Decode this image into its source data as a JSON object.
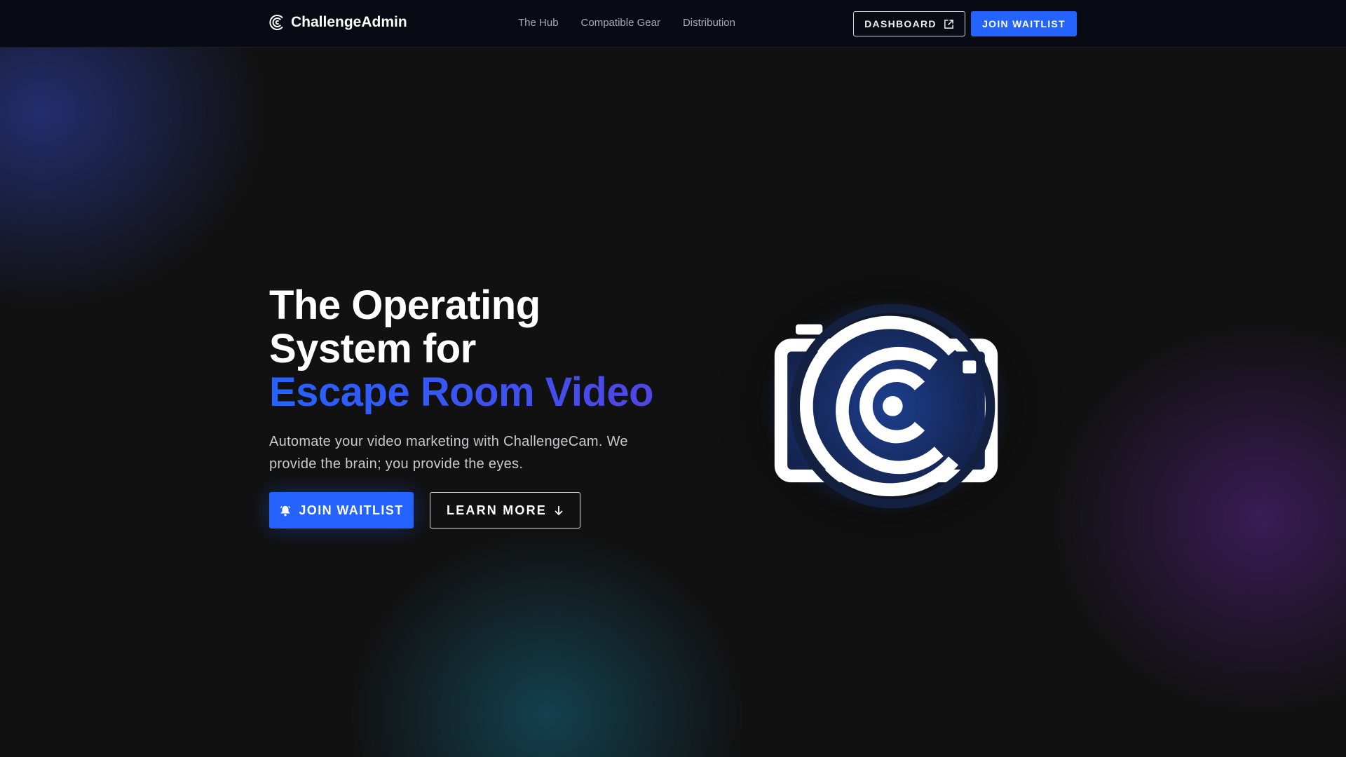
{
  "nav": {
    "brand": "ChallengeAdmin",
    "links": [
      "The Hub",
      "Compatible Gear",
      "Distribution"
    ],
    "dashboard_label": "DASHBOARD",
    "join_label": "JOIN WAITLIST"
  },
  "hero": {
    "title_line1": "The Operating",
    "title_line2": "System for",
    "title_accent": "Escape Room Video",
    "subtitle": "Automate your video marketing with ChallengeCam. We provide the brain; you provide the eyes.",
    "join_label": "JOIN WAITLIST",
    "learn_label": "LEARN MORE"
  },
  "colors": {
    "accent": "#2563ff",
    "accent2": "#4f46e5",
    "background": "#111111"
  }
}
